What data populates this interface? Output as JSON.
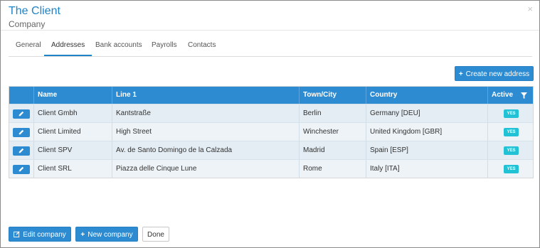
{
  "header": {
    "title": "The Client",
    "subtitle": "Company",
    "close_glyph": "×"
  },
  "tabs": [
    {
      "label": "General",
      "active": false
    },
    {
      "label": "Addresses",
      "active": true
    },
    {
      "label": "Bank accounts",
      "active": false
    },
    {
      "label": "Payrolls",
      "active": false
    },
    {
      "label": "Contacts",
      "active": false
    }
  ],
  "toolbar": {
    "create_label": "Create new address",
    "create_icon": "plus-icon"
  },
  "table": {
    "columns": [
      "Name",
      "Line 1",
      "Town/City",
      "Country",
      "Active"
    ],
    "filter_icon": "filter-icon",
    "rows": [
      {
        "name": "Client Gmbh",
        "line1": "Kantstraße",
        "town": "Berlin",
        "country": "Germany [DEU]",
        "active": "YES"
      },
      {
        "name": "Client Limited",
        "line1": "High Street",
        "town": "Winchester",
        "country": "United Kingdom [GBR]",
        "active": "YES"
      },
      {
        "name": "Client SPV",
        "line1": "Av. de Santo Domingo de la Calzada",
        "town": "Madrid",
        "country": "Spain [ESP]",
        "active": "YES"
      },
      {
        "name": "Client SRL",
        "line1": "Piazza delle Cinque Lune",
        "town": "Rome",
        "country": "Italy [ITA]",
        "active": "YES"
      }
    ]
  },
  "footer": {
    "edit_label": "Edit company",
    "new_label": "New company",
    "done_label": "Done"
  },
  "colors": {
    "accent": "#2d8bd2",
    "badge": "#22c2d6",
    "title": "#1f83c6"
  }
}
